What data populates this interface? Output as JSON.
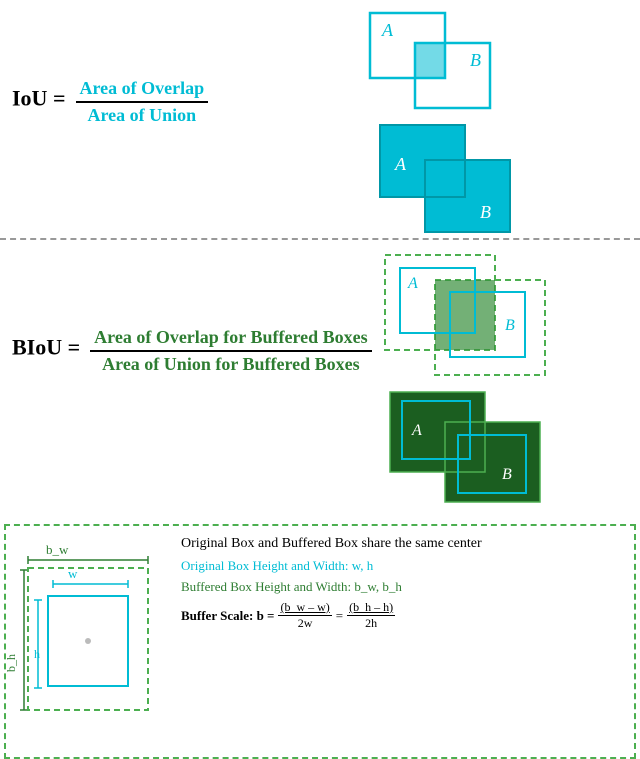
{
  "iou": {
    "label": "IoU =",
    "numerator": "Area of Overlap",
    "denominator": "Area of Union"
  },
  "biou": {
    "label": "BIoU =",
    "numerator": "Area of Overlap for Buffered Boxes",
    "denominator": "Area of Union for Buffered Boxes"
  },
  "legend": {
    "title": "Original Box and Buffered Box share the same center",
    "item1": "Original Box Height and Width: w, h",
    "item2": "Buffered Box Height and Width: b_w, b_h",
    "item3_prefix": "Buffer Scale: b =",
    "item3_frac1_num": "(b_w – w)",
    "item3_frac1_den": "2w",
    "item3_eq": "=",
    "item3_frac2_num": "(b_h – h)",
    "item3_frac2_den": "2h",
    "bw_label": "b_w",
    "w_label": "w",
    "bh_label": "b_h",
    "h_label": "h"
  },
  "colors": {
    "cyan": "#00bcd4",
    "dark_cyan": "#0097a7",
    "green_dark": "#1b5e20",
    "green_medium": "#2e7d32",
    "green_light": "#4caf50",
    "green_fill": "#388e3c"
  }
}
